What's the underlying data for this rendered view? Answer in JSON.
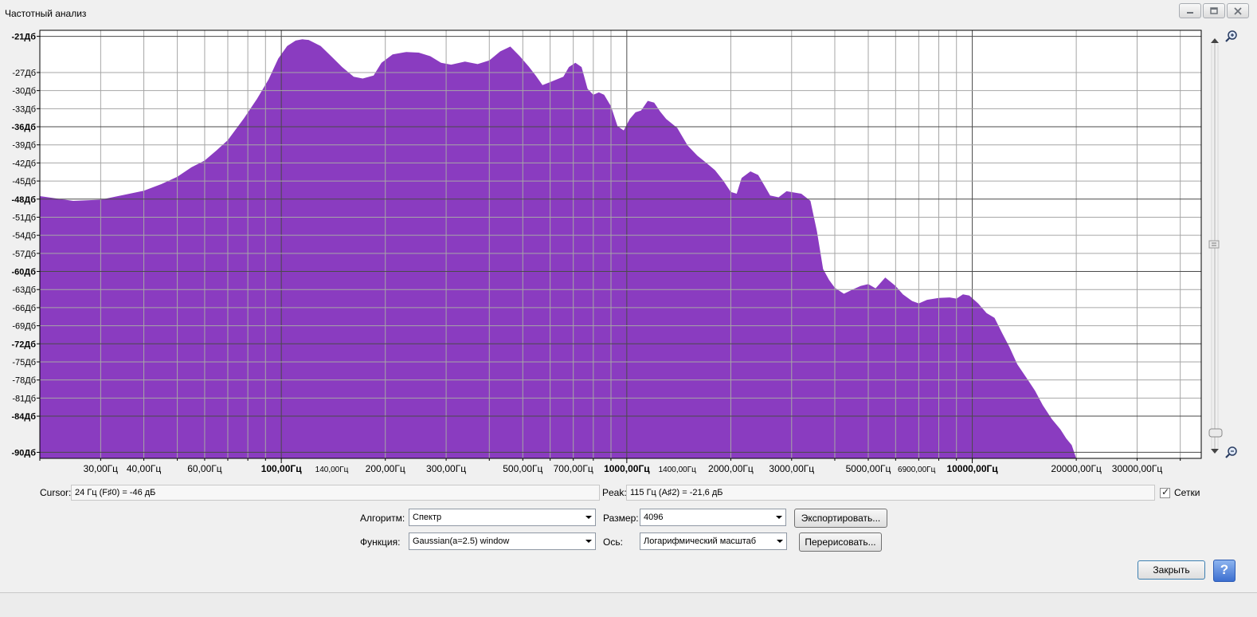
{
  "window": {
    "title": "Частотный анализ"
  },
  "chart_data": {
    "type": "area",
    "fill_color": "#8a3cc0",
    "x_scale": "log",
    "x_tick_labels": [
      {
        "f": 30,
        "label": "30,00Гц",
        "bold": false,
        "small": false
      },
      {
        "f": 40,
        "label": "40,00Гц",
        "bold": false,
        "small": false
      },
      {
        "f": 60,
        "label": "60,00Гц",
        "bold": false,
        "small": false
      },
      {
        "f": 100,
        "label": "100,00Гц",
        "bold": true,
        "small": false
      },
      {
        "f": 140,
        "label": "140,00Гц",
        "bold": false,
        "small": true
      },
      {
        "f": 200,
        "label": "200,00Гц",
        "bold": false,
        "small": false
      },
      {
        "f": 300,
        "label": "300,00Гц",
        "bold": false,
        "small": false
      },
      {
        "f": 500,
        "label": "500,00Гц",
        "bold": false,
        "small": false
      },
      {
        "f": 700,
        "label": "700,00Гц",
        "bold": false,
        "small": false
      },
      {
        "f": 1000,
        "label": "1000,00Гц",
        "bold": true,
        "small": false
      },
      {
        "f": 1400,
        "label": "1400,00Гц",
        "bold": false,
        "small": true
      },
      {
        "f": 2000,
        "label": "2000,00Гц",
        "bold": false,
        "small": false
      },
      {
        "f": 3000,
        "label": "3000,00Гц",
        "bold": false,
        "small": false
      },
      {
        "f": 5000,
        "label": "5000,00Гц",
        "bold": false,
        "small": false
      },
      {
        "f": 6900,
        "label": "6900,00Гц",
        "bold": false,
        "small": true
      },
      {
        "f": 10000,
        "label": "10000,00Гц",
        "bold": true,
        "small": false
      },
      {
        "f": 20000,
        "label": "20000,00Гц",
        "bold": false,
        "small": false
      },
      {
        "f": 30000,
        "label": "30000,00Гц",
        "bold": false,
        "small": false
      }
    ],
    "y_tick_labels": [
      {
        "db": -21,
        "label": "-21Дб",
        "bold": true
      },
      {
        "db": -27,
        "label": "-27Дб",
        "bold": false
      },
      {
        "db": -30,
        "label": "-30Дб",
        "bold": false
      },
      {
        "db": -33,
        "label": "-33Дб",
        "bold": false
      },
      {
        "db": -36,
        "label": "-36Дб",
        "bold": true
      },
      {
        "db": -39,
        "label": "-39Дб",
        "bold": false
      },
      {
        "db": -42,
        "label": "-42Дб",
        "bold": false
      },
      {
        "db": -45,
        "label": "-45Дб",
        "bold": false
      },
      {
        "db": -48,
        "label": "-48Дб",
        "bold": true
      },
      {
        "db": -51,
        "label": "-51Дб",
        "bold": false
      },
      {
        "db": -54,
        "label": "-54Дб",
        "bold": false
      },
      {
        "db": -57,
        "label": "-57Дб",
        "bold": false
      },
      {
        "db": -60,
        "label": "-60Дб",
        "bold": true
      },
      {
        "db": -63,
        "label": "-63Дб",
        "bold": false
      },
      {
        "db": -66,
        "label": "-66Дб",
        "bold": false
      },
      {
        "db": -69,
        "label": "-69Дб",
        "bold": false
      },
      {
        "db": -72,
        "label": "-72Дб",
        "bold": true
      },
      {
        "db": -75,
        "label": "-75Дб",
        "bold": false
      },
      {
        "db": -78,
        "label": "-78Дб",
        "bold": false
      },
      {
        "db": -81,
        "label": "-81Дб",
        "bold": false
      },
      {
        "db": -84,
        "label": "-84Дб",
        "bold": true
      },
      {
        "db": -90,
        "label": "-90Дб",
        "bold": true
      }
    ],
    "ylim": [
      -91,
      -20
    ],
    "grid": true,
    "series": [
      {
        "points": [
          [
            20,
            -47.5
          ],
          [
            25,
            -48.3
          ],
          [
            30,
            -48.1
          ],
          [
            35,
            -47.3
          ],
          [
            40,
            -46.6
          ],
          [
            45,
            -45.5
          ],
          [
            50,
            -44.3
          ],
          [
            55,
            -42.7
          ],
          [
            60,
            -41.6
          ],
          [
            65,
            -39.9
          ],
          [
            70,
            -38.2
          ],
          [
            78,
            -34.6
          ],
          [
            85,
            -31.4
          ],
          [
            92,
            -28.1
          ],
          [
            98,
            -24.7
          ],
          [
            104,
            -22.6
          ],
          [
            110,
            -21.7
          ],
          [
            115,
            -21.5
          ],
          [
            120,
            -21.6
          ],
          [
            130,
            -22.6
          ],
          [
            140,
            -24.4
          ],
          [
            150,
            -26.1
          ],
          [
            162,
            -27.7
          ],
          [
            172,
            -28.0
          ],
          [
            185,
            -27.5
          ],
          [
            195,
            -25.4
          ],
          [
            210,
            -24.0
          ],
          [
            230,
            -23.6
          ],
          [
            250,
            -23.7
          ],
          [
            270,
            -24.3
          ],
          [
            290,
            -25.4
          ],
          [
            310,
            -25.7
          ],
          [
            340,
            -25.2
          ],
          [
            370,
            -25.6
          ],
          [
            400,
            -25.0
          ],
          [
            430,
            -23.5
          ],
          [
            460,
            -22.7
          ],
          [
            490,
            -24.3
          ],
          [
            520,
            -26.0
          ],
          [
            545,
            -27.5
          ],
          [
            570,
            -29.1
          ],
          [
            600,
            -28.6
          ],
          [
            630,
            -28.1
          ],
          [
            655,
            -27.7
          ],
          [
            680,
            -26.1
          ],
          [
            710,
            -25.4
          ],
          [
            740,
            -26.1
          ],
          [
            770,
            -29.7
          ],
          [
            800,
            -30.7
          ],
          [
            830,
            -30.3
          ],
          [
            860,
            -30.7
          ],
          [
            900,
            -32.6
          ],
          [
            940,
            -35.9
          ],
          [
            980,
            -36.6
          ],
          [
            1020,
            -34.7
          ],
          [
            1060,
            -33.6
          ],
          [
            1100,
            -33.3
          ],
          [
            1150,
            -31.7
          ],
          [
            1200,
            -32.0
          ],
          [
            1250,
            -33.5
          ],
          [
            1300,
            -34.7
          ],
          [
            1400,
            -36.2
          ],
          [
            1500,
            -39.1
          ],
          [
            1600,
            -40.8
          ],
          [
            1700,
            -42.0
          ],
          [
            1800,
            -43.2
          ],
          [
            1900,
            -44.9
          ],
          [
            2000,
            -46.8
          ],
          [
            2080,
            -47.1
          ],
          [
            2150,
            -44.5
          ],
          [
            2280,
            -43.4
          ],
          [
            2400,
            -44.0
          ],
          [
            2500,
            -45.7
          ],
          [
            2600,
            -47.4
          ],
          [
            2750,
            -47.7
          ],
          [
            2900,
            -46.7
          ],
          [
            3050,
            -46.9
          ],
          [
            3200,
            -47.1
          ],
          [
            3400,
            -48.3
          ],
          [
            3550,
            -53.3
          ],
          [
            3700,
            -59.6
          ],
          [
            3850,
            -61.4
          ],
          [
            4000,
            -62.7
          ],
          [
            4250,
            -63.7
          ],
          [
            4500,
            -63.0
          ],
          [
            4750,
            -62.4
          ],
          [
            5000,
            -62.1
          ],
          [
            5250,
            -62.8
          ],
          [
            5600,
            -61.0
          ],
          [
            6000,
            -62.4
          ],
          [
            6300,
            -63.8
          ],
          [
            6700,
            -64.9
          ],
          [
            7000,
            -65.3
          ],
          [
            7400,
            -64.7
          ],
          [
            8000,
            -64.4
          ],
          [
            8600,
            -64.3
          ],
          [
            9000,
            -64.5
          ],
          [
            9400,
            -63.8
          ],
          [
            9800,
            -64.0
          ],
          [
            10400,
            -65.3
          ],
          [
            11000,
            -66.9
          ],
          [
            11600,
            -67.7
          ],
          [
            12200,
            -70.2
          ],
          [
            12800,
            -72.5
          ],
          [
            13500,
            -75.4
          ],
          [
            14500,
            -78.0
          ],
          [
            15200,
            -79.8
          ],
          [
            16000,
            -82.2
          ],
          [
            17000,
            -84.5
          ],
          [
            18000,
            -86.2
          ],
          [
            18700,
            -87.7
          ],
          [
            19400,
            -88.8
          ],
          [
            20000,
            -91
          ]
        ]
      }
    ]
  },
  "cursor": {
    "label": "Cursor:",
    "value": "24 Гц (F♯0) = -46 дБ"
  },
  "peak": {
    "label": "Peak:",
    "value": "115 Гц (A♯2) = -21,6 дБ"
  },
  "grid_toggle": {
    "label": "Сетки",
    "checked": true,
    "checkmark": "✓"
  },
  "algorithm": {
    "label": "Алгоритм:",
    "value": "Спектр"
  },
  "function": {
    "label": "Функция:",
    "value": "Gaussian(a=2.5) window"
  },
  "size": {
    "label": "Размер:",
    "value": "4096"
  },
  "axis": {
    "label": "Ось:",
    "value": "Логарифмический масштаб"
  },
  "buttons": {
    "export": "Экспортировать...",
    "redraw": "Перерисовать...",
    "close": "Закрыть",
    "help": "?"
  },
  "icons": {
    "zoom_in": "zoom-in-icon",
    "zoom_out": "zoom-out-icon",
    "minimize": "minimize-icon",
    "maximize": "maximize-icon",
    "close": "close-icon"
  }
}
